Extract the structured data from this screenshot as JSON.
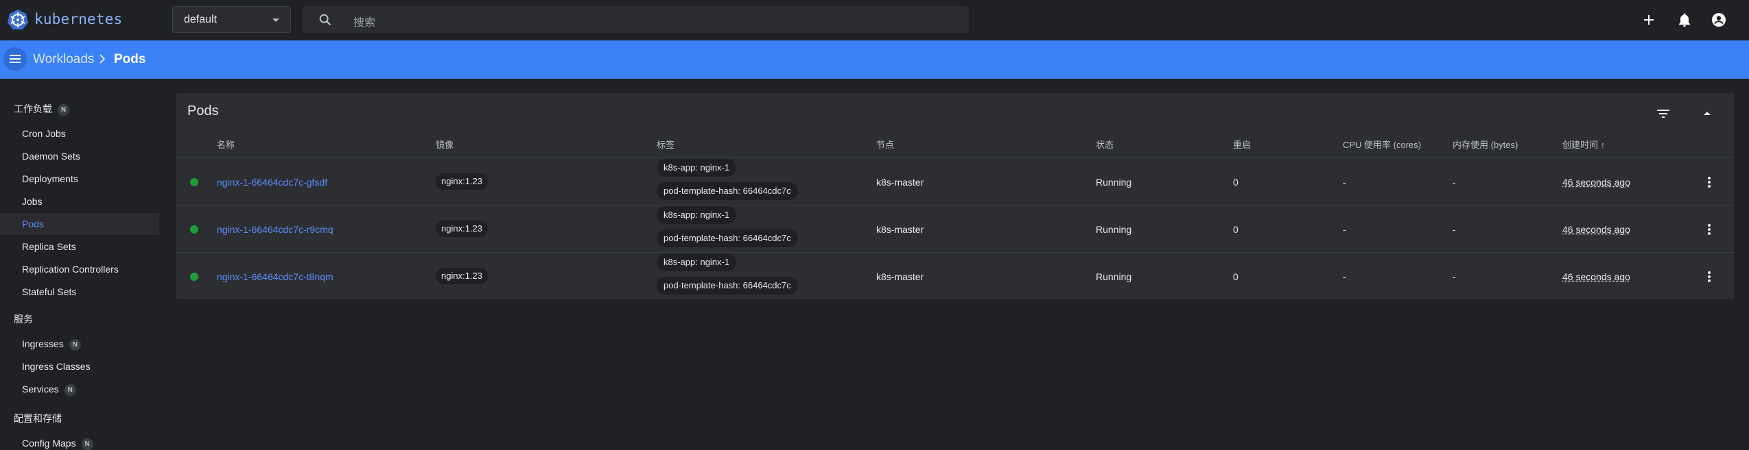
{
  "app": {
    "brand": "kubernetes",
    "namespace": "default",
    "search_placeholder": "搜索"
  },
  "breadcrumb": {
    "parent": "Workloads",
    "current": "Pods"
  },
  "sidebar": {
    "groups": [
      {
        "label": "工作负载",
        "badge": "N"
      },
      {
        "label": "服务"
      },
      {
        "label": "配置和存储"
      }
    ],
    "workloads": [
      "Cron Jobs",
      "Daemon Sets",
      "Deployments",
      "Jobs",
      "Pods",
      "Replica Sets",
      "Replication Controllers",
      "Stateful Sets"
    ],
    "services": [
      {
        "label": "Ingresses",
        "badge": "N"
      },
      {
        "label": "Ingress Classes"
      },
      {
        "label": "Services",
        "badge": "N"
      }
    ],
    "config": [
      {
        "label": "Config Maps",
        "badge": "N"
      }
    ],
    "active": "Pods"
  },
  "card": {
    "title": "Pods",
    "columns": [
      "名称",
      "镜像",
      "标签",
      "节点",
      "状态",
      "重启",
      "CPU 使用率 (cores)",
      "内存使用 (bytes)",
      "创建时间 ↑"
    ],
    "rows": [
      {
        "name": "nginx-1-66464cdc7c-gfsdf",
        "image": "nginx:1.23",
        "labels": [
          "k8s-app: nginx-1",
          "pod-template-hash: 66464cdc7c"
        ],
        "node": "k8s-master",
        "status": "Running",
        "restarts": "0",
        "cpu": "-",
        "mem": "-",
        "created": "46 seconds ago"
      },
      {
        "name": "nginx-1-66464cdc7c-r9cmq",
        "image": "nginx:1.23",
        "labels": [
          "k8s-app: nginx-1",
          "pod-template-hash: 66464cdc7c"
        ],
        "node": "k8s-master",
        "status": "Running",
        "restarts": "0",
        "cpu": "-",
        "mem": "-",
        "created": "46 seconds ago"
      },
      {
        "name": "nginx-1-66464cdc7c-t8nqm",
        "image": "nginx:1.23",
        "labels": [
          "k8s-app: nginx-1",
          "pod-template-hash: 66464cdc7c"
        ],
        "node": "k8s-master",
        "status": "Running",
        "restarts": "0",
        "cpu": "-",
        "mem": "-",
        "created": "46 seconds ago"
      }
    ]
  },
  "colors": {
    "accent": "#3a82f6",
    "running": "#1e9e3a",
    "link": "#5b8cff"
  },
  "icons": {
    "logo": "kubernetes-wheel-icon",
    "search": "search-icon",
    "add": "plus-icon",
    "notifications": "bell-icon",
    "account": "account-icon",
    "menu": "hamburger-icon",
    "filter": "filter-icon",
    "collapse": "chevron-up-icon",
    "row_actions": "more-vert-icon"
  }
}
